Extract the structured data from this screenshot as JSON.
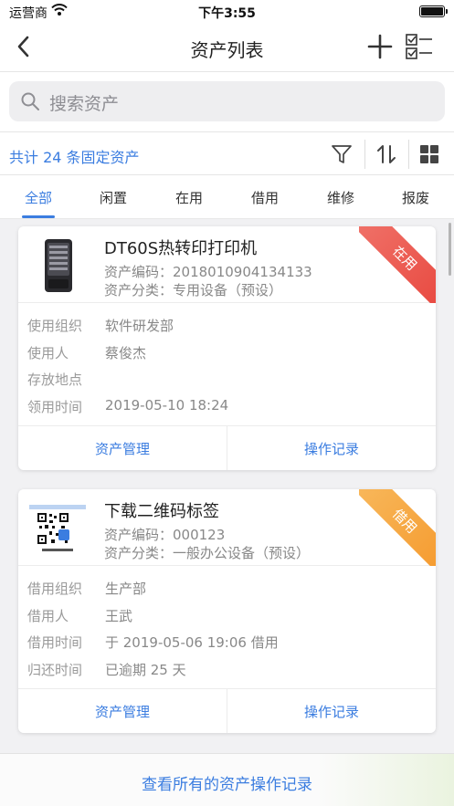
{
  "status_bar": {
    "carrier": "运营商",
    "time": "下午3:55"
  },
  "nav": {
    "title": "资产列表",
    "back_icon": "chevron-left-icon",
    "add_icon": "plus-icon",
    "select_icon": "checklist-icon"
  },
  "search": {
    "placeholder": "搜索资产"
  },
  "summary": {
    "count_text": "共计 24 条固定资产"
  },
  "tabs": [
    {
      "label": "全部",
      "active": true
    },
    {
      "label": "闲置"
    },
    {
      "label": "在用"
    },
    {
      "label": "借用"
    },
    {
      "label": "维修"
    },
    {
      "label": "报废"
    }
  ],
  "cards": [
    {
      "name": "DT60S热转印打印机",
      "code": "资产编码：2018010904134133",
      "category": "资产分类：专用设备（预设）",
      "status": "在用",
      "status_color": "#e8483f",
      "rows": [
        {
          "label": "使用组织",
          "value": "软件研发部"
        },
        {
          "label": "使用人",
          "value": "蔡俊杰"
        },
        {
          "label": "存放地点",
          "value": ""
        },
        {
          "label": "领用时间",
          "value": "2019-05-10 18:24"
        }
      ],
      "actions": {
        "left": "资产管理",
        "right": "操作记录"
      }
    },
    {
      "name": "下载二维码标签",
      "code": "资产编码：000123",
      "category": "资产分类：一般办公设备（预设）",
      "status": "借用",
      "status_color": "#f59a2e",
      "rows": [
        {
          "label": "借用组织",
          "value": "生产部"
        },
        {
          "label": "借用人",
          "value": "王武"
        },
        {
          "label": "借用时间",
          "value": "于 2019-05-06 19:06 借用"
        },
        {
          "label": "归还时间",
          "value": "已逾期 25 天"
        }
      ],
      "actions": {
        "left": "资产管理",
        "right": "操作记录"
      }
    }
  ],
  "bottom": {
    "link_text": "查看所有的资产操作记录"
  },
  "colors": {
    "accent": "#3b7de0"
  }
}
